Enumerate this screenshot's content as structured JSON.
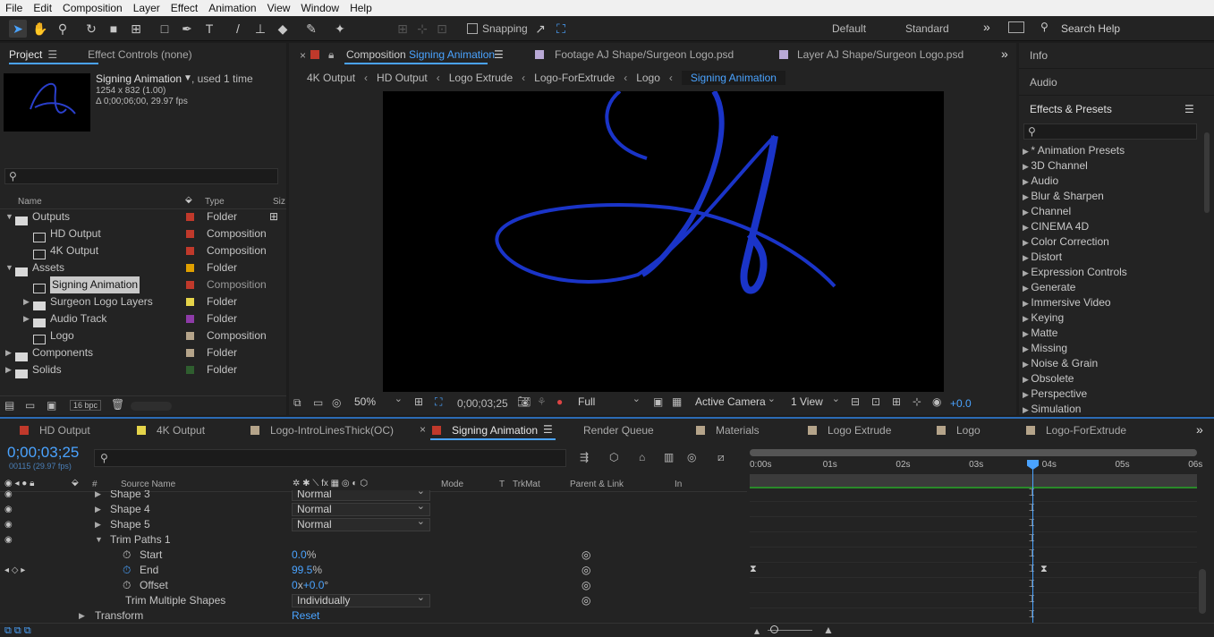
{
  "menu": [
    "File",
    "Edit",
    "Composition",
    "Layer",
    "Effect",
    "Animation",
    "View",
    "Window",
    "Help"
  ],
  "toolbar": {
    "snapping": "Snapping",
    "workspace_default": "Default",
    "workspace_standard": "Standard",
    "search_placeholder": "Search Help"
  },
  "project": {
    "tab": "Project",
    "effect_controls": "Effect Controls (none)",
    "comp_name": "Signing Animation",
    "used": ", used 1 time",
    "dims": "1254 x 832 (1.00)",
    "duration": "Δ 0;00;06;00, 29.97 fps",
    "col_name": "Name",
    "col_type": "Type",
    "col_size": "Siz",
    "items": [
      {
        "name": "Outputs",
        "type": "Folder",
        "label": "#c0392b",
        "kind": "folder",
        "indent": 0,
        "open": true
      },
      {
        "name": "HD Output",
        "type": "Composition",
        "label": "#c0392b",
        "kind": "comp",
        "indent": 1
      },
      {
        "name": "4K Output",
        "type": "Composition",
        "label": "#c0392b",
        "kind": "comp",
        "indent": 1
      },
      {
        "name": "Assets",
        "type": "Folder",
        "label": "#e0a000",
        "kind": "folder",
        "indent": 0,
        "open": true
      },
      {
        "name": "Signing Animation",
        "type": "Composition",
        "label": "#c0392b",
        "kind": "comp",
        "indent": 1,
        "selected": true
      },
      {
        "name": "Surgeon Logo Layers",
        "type": "Folder",
        "label": "#e5d44a",
        "kind": "folder",
        "indent": 1
      },
      {
        "name": "Audio Track",
        "type": "Folder",
        "label": "#8e3ba8",
        "kind": "folder",
        "indent": 1
      },
      {
        "name": "Logo",
        "type": "Composition",
        "label": "#b5a48a",
        "kind": "comp",
        "indent": 1
      },
      {
        "name": "Components",
        "type": "Folder",
        "label": "#b5a48a",
        "kind": "folder",
        "indent": 0
      },
      {
        "name": "Solids",
        "type": "Folder",
        "label": "#2f5e2f",
        "kind": "folder",
        "indent": 0
      }
    ],
    "bpc": "16 bpc"
  },
  "viewer": {
    "tabs": [
      {
        "prefix": "Composition ",
        "name": "Signing Animation",
        "swatch": "#c0392b"
      },
      {
        "prefix": "Footage ",
        "name": "AJ Shape/Surgeon Logo.psd",
        "swatch": "#b9a9d6"
      },
      {
        "prefix": "Layer ",
        "name": "AJ Shape/Surgeon Logo.psd",
        "swatch": "#b9a9d6"
      }
    ],
    "breadcrumbs": [
      "4K Output",
      "HD Output",
      "Logo Extrude",
      "Logo-ForExtrude",
      "Logo",
      "Signing Animation"
    ],
    "zoom": "50%",
    "timecode": "0;00;03;25",
    "resolution": "Full",
    "camera": "Active Camera",
    "views": "1 View",
    "exposure": "+0.0"
  },
  "right": {
    "info": "Info",
    "audio": "Audio",
    "effects": "Effects & Presets",
    "items": [
      "* Animation Presets",
      "3D Channel",
      "Audio",
      "Blur & Sharpen",
      "Channel",
      "CINEMA 4D",
      "Color Correction",
      "Distort",
      "Expression Controls",
      "Generate",
      "Immersive Video",
      "Keying",
      "Matte",
      "Missing",
      "Noise & Grain",
      "Obsolete",
      "Perspective",
      "Simulation"
    ]
  },
  "timeline": {
    "tabs": [
      {
        "name": "HD Output",
        "swatch": "#c0392b"
      },
      {
        "name": "4K Output",
        "swatch": "#e5d44a"
      },
      {
        "name": "Logo-IntroLinesThick(OC)",
        "swatch": "#b5a48a"
      },
      {
        "name": "Signing Animation",
        "swatch": "#c0392b",
        "active": true
      },
      {
        "name": "Render Queue",
        "swatch": ""
      },
      {
        "name": "Materials",
        "swatch": "#b5a48a"
      },
      {
        "name": "Logo Extrude",
        "swatch": "#b5a48a"
      },
      {
        "name": "Logo",
        "swatch": "#b5a48a"
      },
      {
        "name": "Logo-ForExtrude",
        "swatch": "#b5a48a"
      }
    ],
    "timecode": "0;00;03;25",
    "frame": "00115 (29.97 fps)",
    "cols": {
      "hash": "#",
      "source": "Source Name",
      "mode": "Mode",
      "t": "T",
      "trkmat": "TrkMat",
      "parent": "Parent & Link",
      "in": "In"
    },
    "ruler": [
      "0:00s",
      "01s",
      "02s",
      "03s",
      "04s",
      "05s",
      "06s"
    ],
    "rows": [
      {
        "name": "Shape 3",
        "mode": "Normal"
      },
      {
        "name": "Shape 4",
        "mode": "Normal"
      },
      {
        "name": "Shape 5",
        "mode": "Normal"
      },
      {
        "name": "Trim Paths 1"
      },
      {
        "name": "Start",
        "value": "0.0",
        "unit": "%"
      },
      {
        "name": "End",
        "value": "99.5",
        "unit": "%"
      },
      {
        "name": "Offset",
        "value": "0",
        "unit": "x",
        "value2": "+0.0",
        "unit2": "°"
      },
      {
        "name": "Trim Multiple Shapes",
        "mode": "Individually"
      },
      {
        "name": "Transform",
        "reset": "Reset"
      }
    ]
  }
}
